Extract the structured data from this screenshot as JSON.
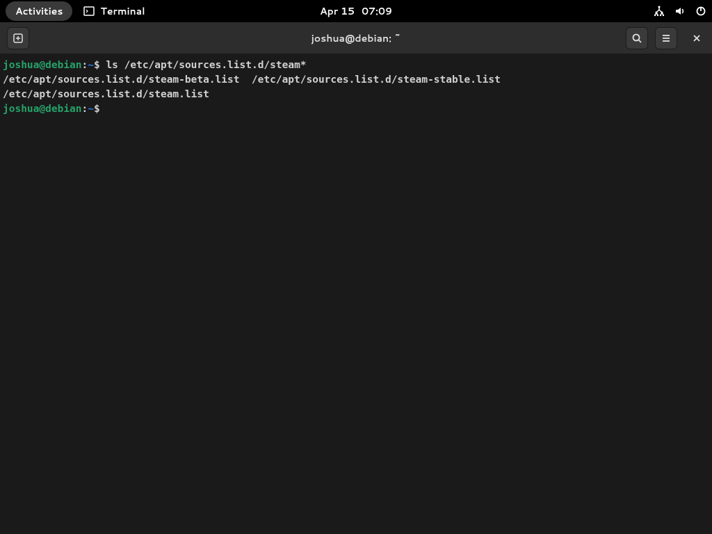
{
  "topbar": {
    "activities": "Activities",
    "app_name": "Terminal",
    "date": "Apr 15",
    "time": "07:09"
  },
  "window": {
    "title": "joshua@debian: ~"
  },
  "terminal": {
    "lines": [
      {
        "type": "prompt",
        "user": "joshua",
        "at": "@",
        "host": "debian",
        "colon": ":",
        "path": "~",
        "dollar": "$ ",
        "command": "ls /etc/apt/sources.list.d/steam*"
      },
      {
        "type": "output",
        "text": "/etc/apt/sources.list.d/steam-beta.list  /etc/apt/sources.list.d/steam-stable.list"
      },
      {
        "type": "output",
        "text": "/etc/apt/sources.list.d/steam.list"
      },
      {
        "type": "prompt",
        "user": "joshua",
        "at": "@",
        "host": "debian",
        "colon": ":",
        "path": "~",
        "dollar": "$ ",
        "command": ""
      }
    ]
  }
}
